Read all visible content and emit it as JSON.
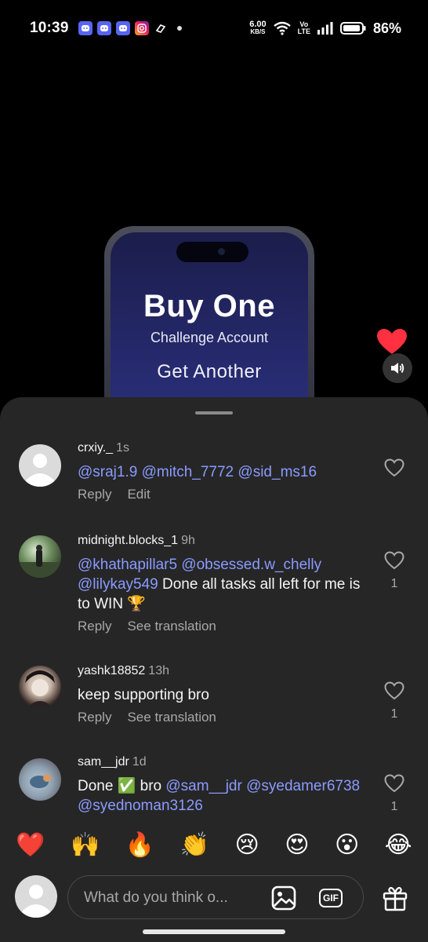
{
  "status_bar": {
    "time": "10:39",
    "net_speed": "6.00",
    "net_unit": "KB/S",
    "volte_top": "Vo",
    "volte_bottom": "LTE",
    "battery": "86%",
    "notification_icons": [
      "discord-icon",
      "discord-icon",
      "discord-icon",
      "instagram-icon",
      "app-icon"
    ]
  },
  "video": {
    "promo_big": "Buy One",
    "promo_sub": "Challenge Account",
    "promo_get": "Get Another"
  },
  "comments": [
    {
      "username": "crxiy._",
      "time": "1s",
      "mentions": [
        "@sraj1.9",
        "@mitch_7772",
        "@sid_ms16"
      ],
      "text": "",
      "actions": [
        "Reply",
        "Edit"
      ],
      "likes": ""
    },
    {
      "username": "midnight.blocks_1",
      "time": "9h",
      "mentions": [
        "@khathapillar5",
        "@obsessed.w_chelly",
        "@lilykay549"
      ],
      "text": "Done all tasks all left for me is to WIN 🏆",
      "actions": [
        "Reply",
        "See translation"
      ],
      "likes": "1"
    },
    {
      "username": "yashk18852",
      "time": "13h",
      "mentions": [],
      "text": "keep supporting bro",
      "actions": [
        "Reply",
        "See translation"
      ],
      "likes": "1"
    },
    {
      "username": "sam__jdr",
      "time": "1d",
      "mentions": [
        "@sam__jdr",
        "@syedamer6738",
        "@syednoman3126"
      ],
      "text_prefix": "Done ✅ bro",
      "actions": [],
      "likes": "1"
    }
  ],
  "emoji_bar": [
    "❤️",
    "🙌",
    "🔥",
    "👏",
    "😢",
    "😍",
    "😮",
    "😂"
  ],
  "composer": {
    "placeholder": "What do you think o...",
    "gif_label": "GIF"
  },
  "colors": {
    "sheet_bg": "#262626",
    "mention": "#8a9bff",
    "like_red": "#ff3040"
  }
}
